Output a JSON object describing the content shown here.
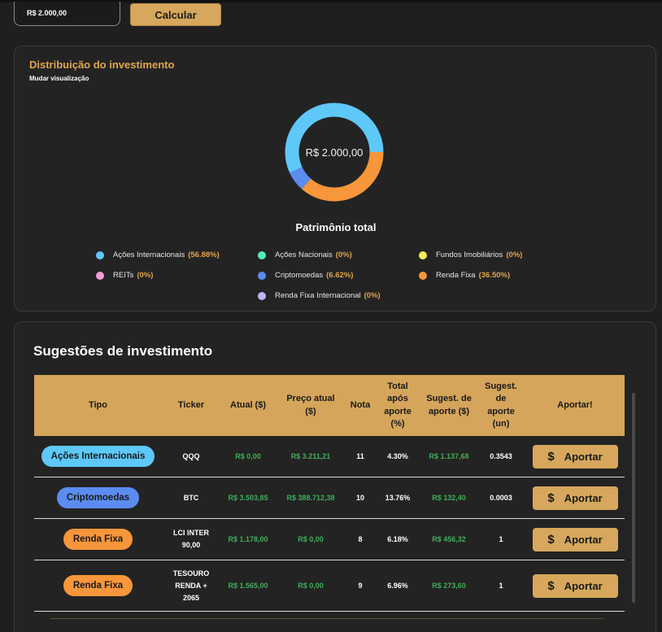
{
  "calculator": {
    "amount_value": "R$ 2.000,00",
    "calculate_label": "Calcular"
  },
  "distribution": {
    "title": "Distribuição do investimento",
    "change_view_label": "Mudar visualização",
    "center_value": "R$ 2.000,00",
    "total_label": "Patrimônio total",
    "legend": [
      {
        "label": "Ações Internacionais",
        "pct": "(56.88%)",
        "color": "#5ec8f8"
      },
      {
        "label": "Ações Nacionais",
        "pct": "(0%)",
        "color": "#4ef0b6"
      },
      {
        "label": "Fundos Imobiliários",
        "pct": "(0%)",
        "color": "#f6ea5a"
      },
      {
        "label": "REITs",
        "pct": "(0%)",
        "color": "#f59ad4"
      },
      {
        "label": "Criptomoedas",
        "pct": "(6.62%)",
        "color": "#5b8cf0"
      },
      {
        "label": "Renda Fixa",
        "pct": "(36.50%)",
        "color": "#f7963a"
      },
      {
        "label": "Renda Fixa Internacional",
        "pct": "(0%)",
        "color": "#c4b2f7"
      }
    ]
  },
  "chart_data": {
    "type": "pie",
    "categories": [
      "Ações Internacionais",
      "Ações Nacionais",
      "Fundos Imobiliários",
      "REITs",
      "Criptomoedas",
      "Renda Fixa",
      "Renda Fixa Internacional"
    ],
    "values": [
      56.88,
      0,
      0,
      0,
      6.62,
      36.5,
      0
    ],
    "colors": [
      "#5ec8f8",
      "#4ef0b6",
      "#f6ea5a",
      "#f59ad4",
      "#5b8cf0",
      "#f7963a",
      "#c4b2f7"
    ],
    "style": "donut",
    "legend_position": "bottom"
  },
  "suggestions": {
    "title": "Sugestões de investimento",
    "headers": {
      "tipo": "Tipo",
      "ticker": "Ticker",
      "atual": "Atual ($)",
      "preco": "Preço atual ($)",
      "nota": "Nota",
      "total": "Total após aporte (%)",
      "sugest_valor": "Sugest. de aporte ($)",
      "sugest_un": "Sugest. de aporte (un)",
      "aportar": "Aportar!"
    },
    "button_label": "Aportar",
    "button_icon": "$",
    "rows": [
      {
        "tipo": "Ações Internacionais",
        "tipo_color": "#5ec8f8",
        "ticker": "QQQ",
        "atual": "R$ 0,00",
        "preco": "R$ 3.211,21",
        "nota": "11",
        "total": "4.30%",
        "sugest_valor": "R$ 1.137,68",
        "sugest_un": "0.3543"
      },
      {
        "tipo": "Criptomoedas",
        "tipo_color": "#5b8cf0",
        "ticker": "BTC",
        "atual": "R$ 3.503,85",
        "preco": "R$ 388.712,38",
        "nota": "10",
        "total": "13.76%",
        "sugest_valor": "R$ 132,40",
        "sugest_un": "0.0003"
      },
      {
        "tipo": "Renda Fixa",
        "tipo_color": "#f7963a",
        "ticker": "LCI INTER 90,00",
        "atual": "R$ 1.178,00",
        "preco": "R$ 0,00",
        "nota": "8",
        "total": "6.18%",
        "sugest_valor": "R$ 456,32",
        "sugest_un": "1"
      },
      {
        "tipo": "Renda Fixa",
        "tipo_color": "#f7963a",
        "ticker": "TESOURO RENDA + 2065",
        "atual": "R$ 1.565,00",
        "preco": "R$ 0,00",
        "nota": "9",
        "total": "6.96%",
        "sugest_valor": "R$ 273,60",
        "sugest_un": "1"
      }
    ]
  }
}
